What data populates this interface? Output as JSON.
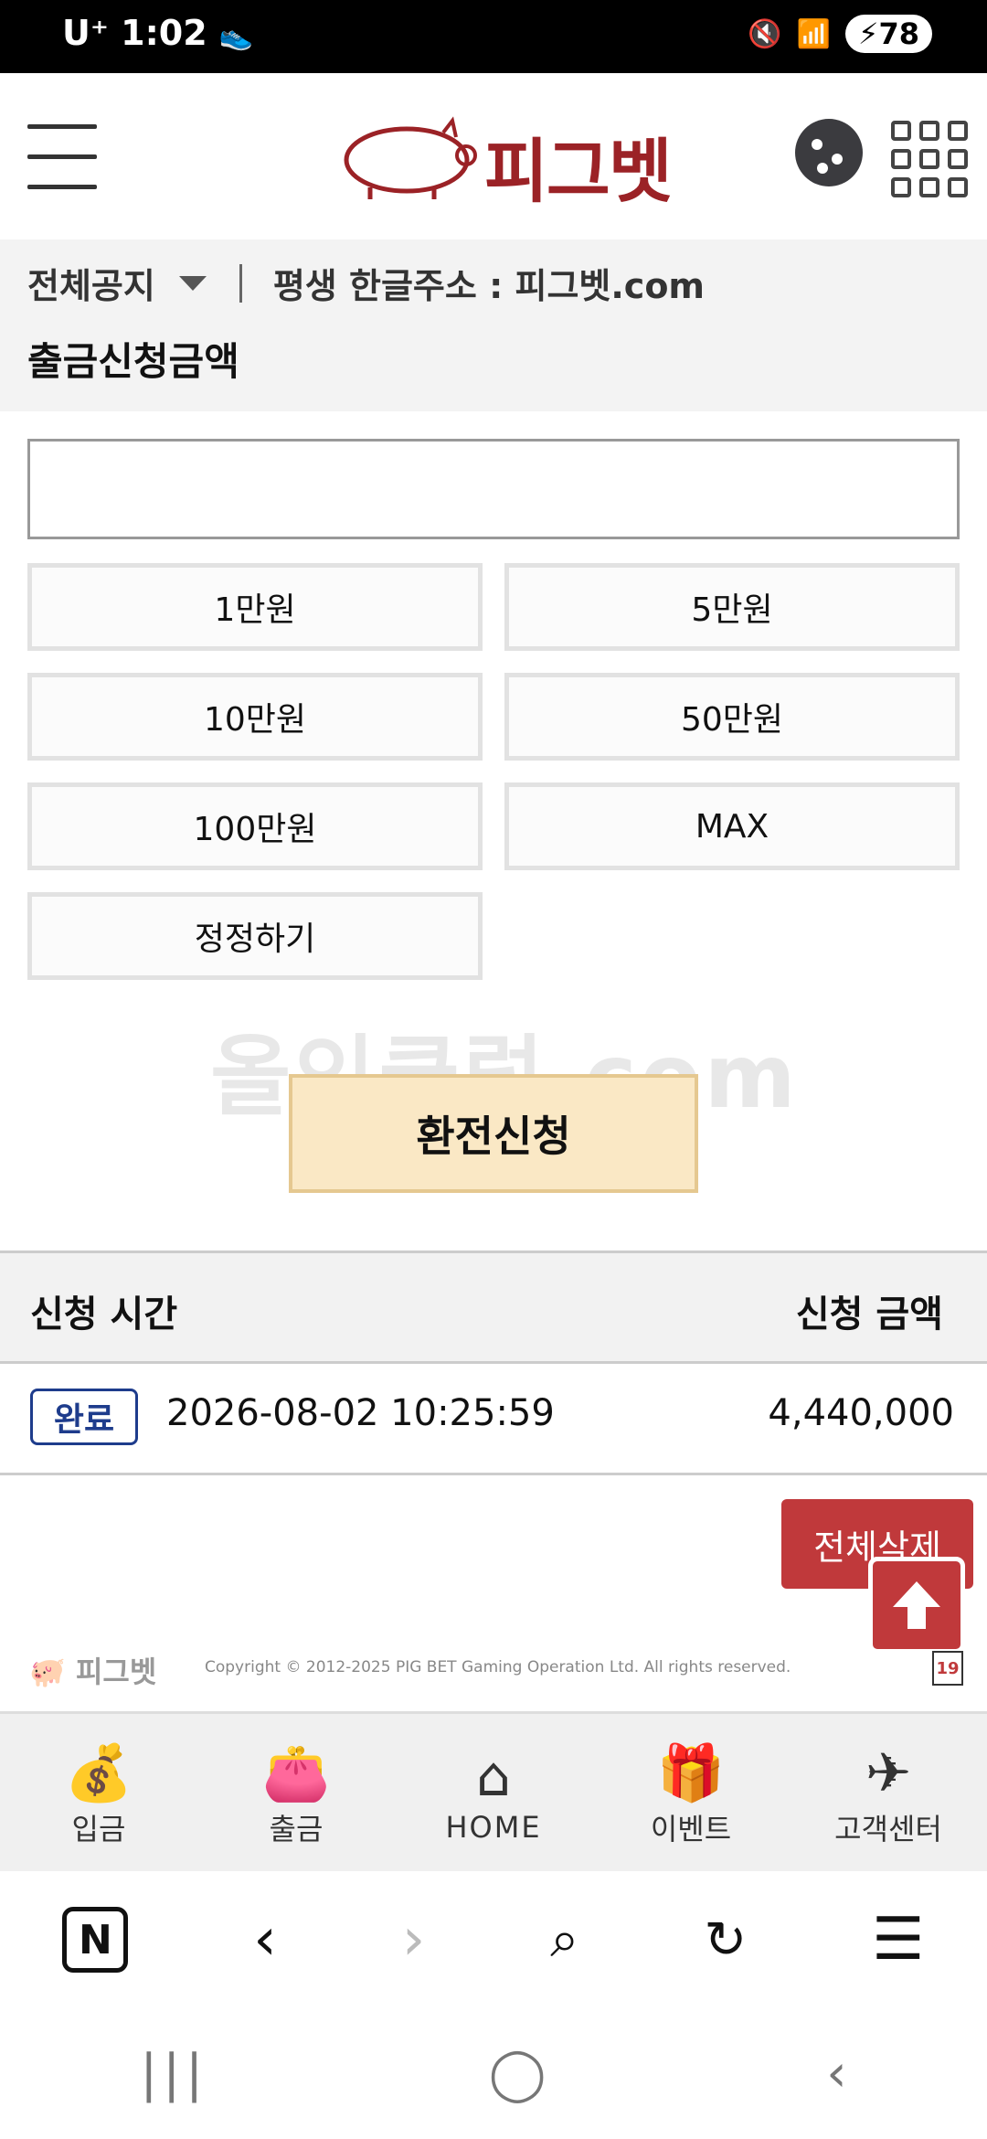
{
  "status_bar": {
    "carrier": "U⁺",
    "time": "1:02",
    "battery": "78"
  },
  "header": {
    "logo_text": "피그벳",
    "icons": [
      "hamburger-menu-icon",
      "cookie-icon",
      "grid-menu-icon"
    ]
  },
  "notice": {
    "dropdown_label": "전체공지",
    "text": "평생 한글주소 : 피그벳.com"
  },
  "form": {
    "title": "출금신청금액",
    "amount_value": "",
    "quick_buttons": [
      "1만원",
      "5만원",
      "10만원",
      "50만원",
      "100만원",
      "MAX"
    ],
    "reset_label": "정정하기",
    "submit_label": "환전신청"
  },
  "watermark": "올인클럽.com",
  "history": {
    "col_time": "신청 시간",
    "col_amount": "신청 금액",
    "rows": [
      {
        "status": "완료",
        "time": "2026-08-02 10:25:59",
        "amount": "4,440,000"
      }
    ]
  },
  "delete_all_label": "전체삭제",
  "footer": {
    "logo_text": "피그벳",
    "copyright": "Copyright © 2012-2025 PIG BET Gaming Operation Ltd. All rights reserved.",
    "age_badge": "19"
  },
  "bottom_nav": [
    {
      "label": "입금",
      "icon": "money-bag-icon"
    },
    {
      "label": "출금",
      "icon": "wallet-icon"
    },
    {
      "label": "HOME",
      "icon": "house-icon"
    },
    {
      "label": "이벤트",
      "icon": "gift-icon"
    },
    {
      "label": "고객센터",
      "icon": "paper-plane-icon"
    }
  ],
  "browser_bar": {
    "icons": [
      "naver-n-icon",
      "back-arrow-icon",
      "forward-arrow-icon",
      "search-icon",
      "refresh-icon",
      "menu-icon"
    ]
  },
  "system_nav": {
    "icons": [
      "recent-apps-icon",
      "home-circle-icon",
      "system-back-icon"
    ]
  },
  "colors": {
    "brand_red": "#9b2226",
    "button_red": "#c0393b",
    "submit_bg": "#fae8c5",
    "badge_blue": "#1e3c8c"
  }
}
